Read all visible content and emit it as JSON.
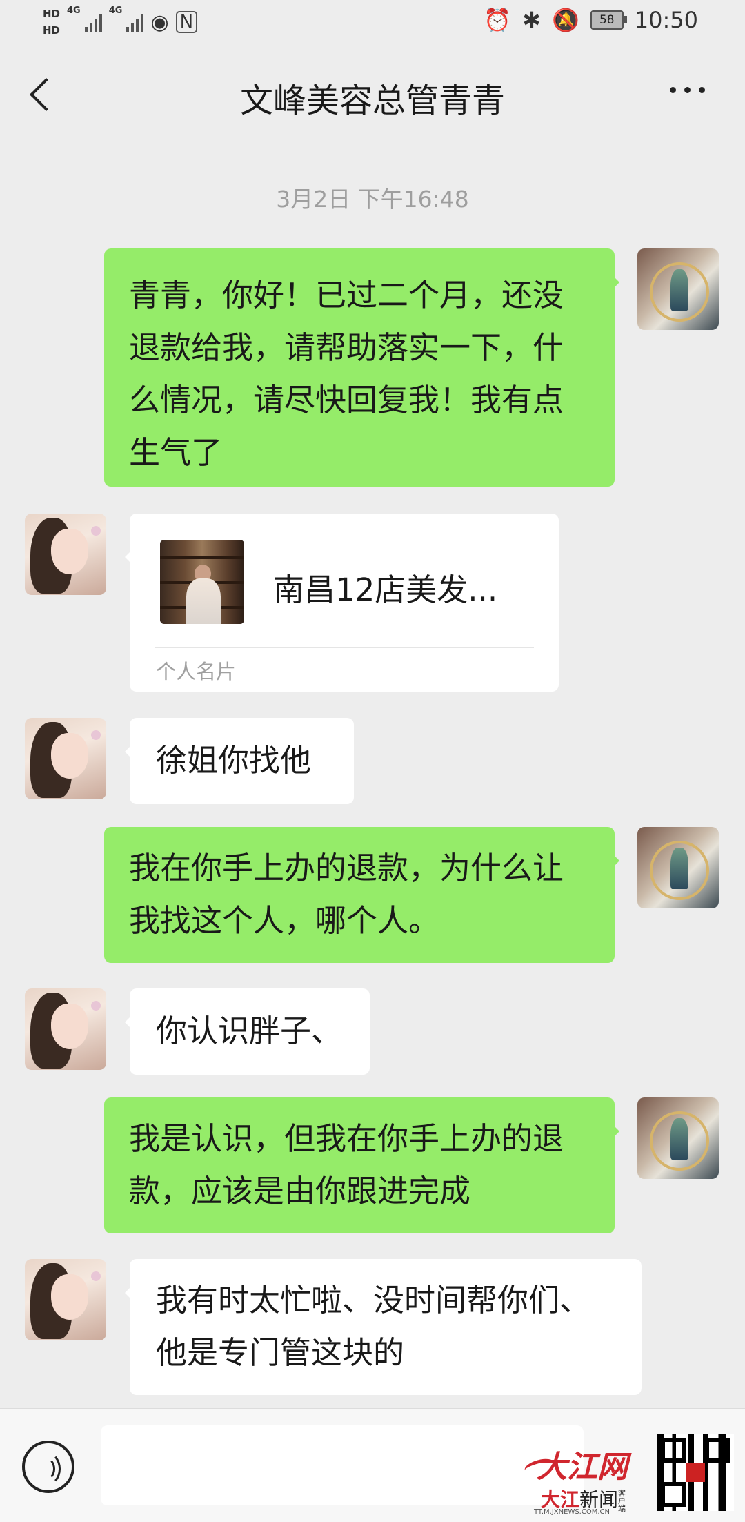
{
  "status_bar": {
    "hd1": "HD",
    "hd2": "HD",
    "net1": "4G",
    "net2": "4G",
    "battery": "58",
    "time": "10:50"
  },
  "header": {
    "title": "文峰美容总管青青"
  },
  "chat": {
    "timestamp": "3月2日 下午16:48",
    "messages": [
      {
        "from": "me",
        "text": "青青，你好！已过二个月，还没退款给我，请帮助落实一下，什么情况，请尽快回复我！我有点生气了"
      },
      {
        "from": "her",
        "type": "card",
        "card_name": "南昌12店美发...",
        "card_label": "个人名片"
      },
      {
        "from": "her",
        "text": "徐姐你找他"
      },
      {
        "from": "me",
        "text": "我在你手上办的退款，为什么让我找这个人，哪个人。"
      },
      {
        "from": "her",
        "text": "你认识胖子、"
      },
      {
        "from": "me",
        "text": "我是认识，但我在你手上办的退款，应该是由你跟进完成"
      },
      {
        "from": "her",
        "text": "我有时太忙啦、没时间帮你们、他是专门管这块的"
      }
    ]
  },
  "watermark": {
    "logo": "大江网",
    "sub_a": "大江",
    "sub_b": "新闻",
    "sub_c": "客户端",
    "url": "TT.M.JXNEWS.COM.CN"
  },
  "icons": {
    "back": "back-arrow-icon",
    "more": "more-icon",
    "voice": "voice-icon"
  }
}
